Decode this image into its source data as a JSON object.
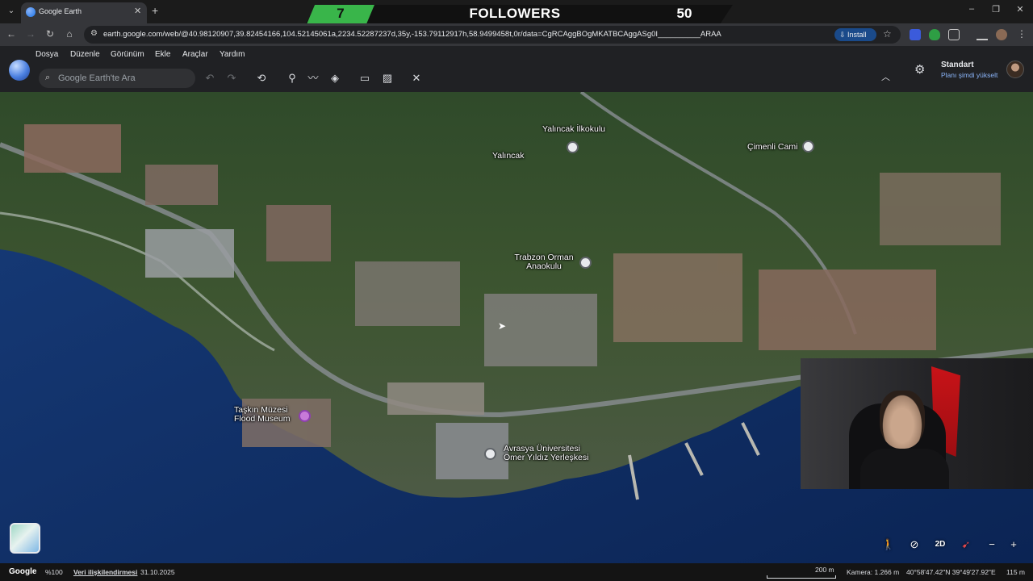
{
  "browser": {
    "tab_title": "Google Earth",
    "url": "earth.google.com/web/@40.98120907,39.82454166,104.52145061a,2234.52287237d,35y,-153.79112917h,58.9499458t,0r/data=CgRCAggBOgMKATBCAggASg0I__________ARAA",
    "install_label": "Install"
  },
  "banner": {
    "count": "7",
    "label": "FOLLOWERS",
    "goal": "50"
  },
  "menu": {
    "items": [
      "Dosya",
      "Düzenle",
      "Görünüm",
      "Ekle",
      "Araçlar",
      "Yardım"
    ]
  },
  "search": {
    "placeholder": "Google Earth'te Ara"
  },
  "account": {
    "plan": "Standart",
    "upgrade": "Planı şimdi yükselt"
  },
  "places": [
    {
      "name": "Yalıncak İlkokulu"
    },
    {
      "name": "Yalıncak"
    },
    {
      "name": "Çimenli Cami"
    },
    {
      "name": "Trabzon Orman Anaokulu"
    },
    {
      "name": "Taşkın Müzesi Flood Museum"
    },
    {
      "name": "Avrasya Üniversitesi Ömer Yıldız Yerleşkesi"
    }
  ],
  "controls": {
    "mode_2d": "2D"
  },
  "status": {
    "brand": "Google",
    "zoom": "%100",
    "attribution": "Veri ilişkilendirmesi",
    "date": "31.10.2025",
    "scale": "200 m",
    "camera": "Kamera: 1.266 m",
    "coords": "40°58'47.42\"N 39°49'27.92\"E",
    "elevation": "115 m"
  },
  "colors": {
    "banner_green": "#39b54a",
    "link_blue": "#8ab4f8",
    "sea": "#0b2a5c"
  }
}
